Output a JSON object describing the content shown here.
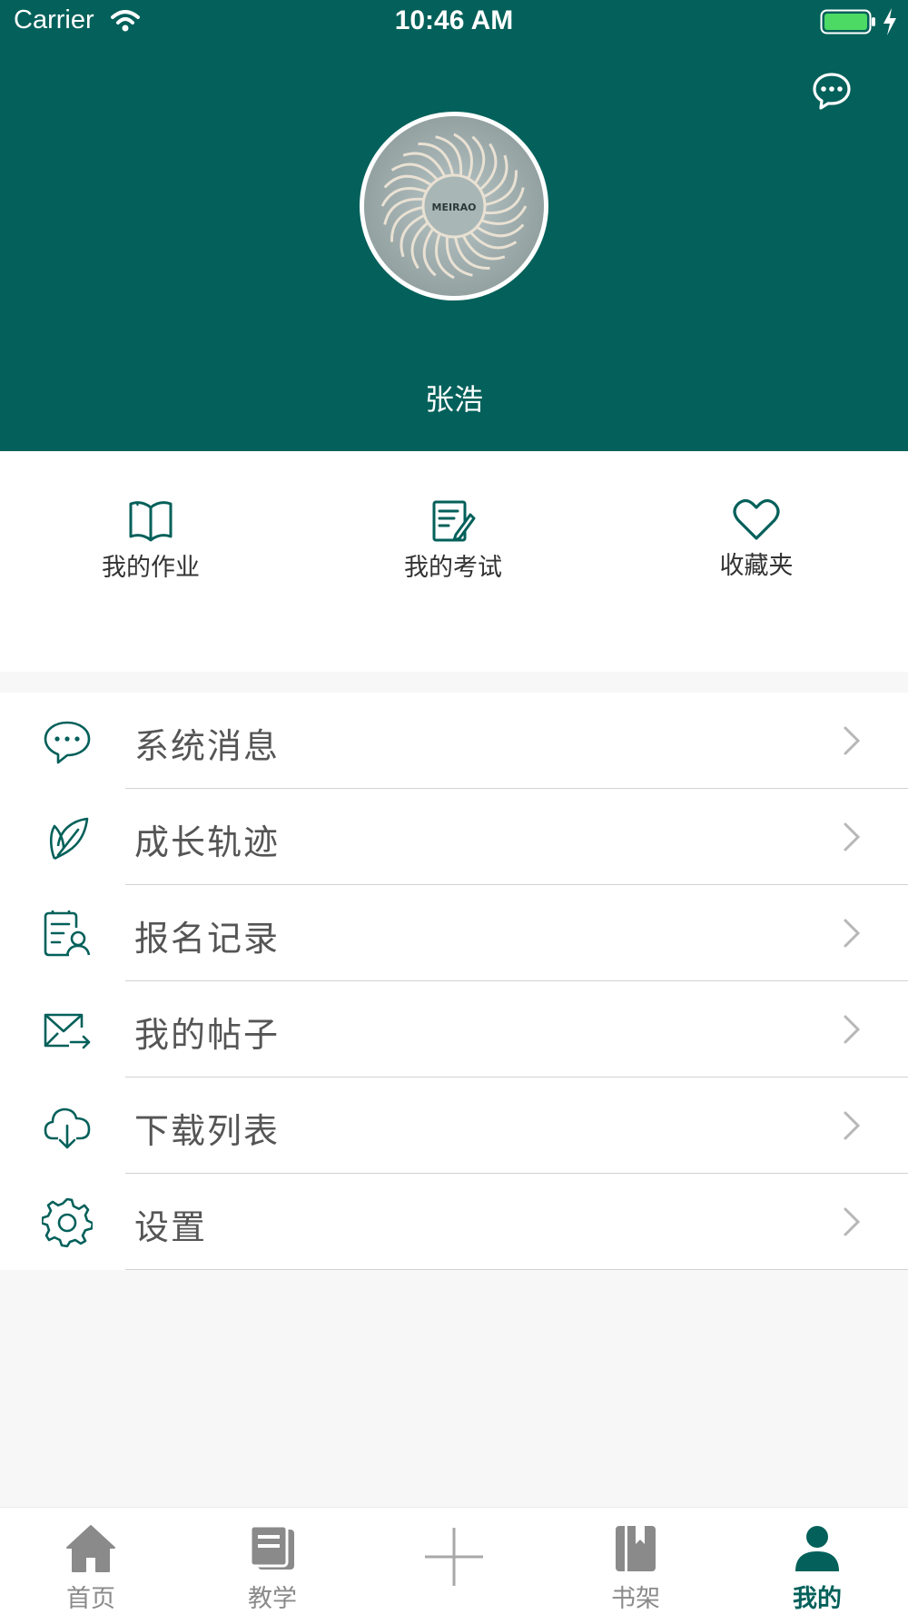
{
  "status_bar": {
    "carrier": "Carrier",
    "time": "10:46 AM"
  },
  "profile": {
    "username": "张浩",
    "avatar_text": "MEIRAO"
  },
  "quick_actions": [
    {
      "label": "我的作业",
      "icon": "book-icon"
    },
    {
      "label": "我的考试",
      "icon": "exam-edit-icon"
    },
    {
      "label": "收藏夹",
      "icon": "heart-icon"
    }
  ],
  "menu": [
    {
      "label": "系统消息",
      "icon": "chat-bubble-icon"
    },
    {
      "label": "成长轨迹",
      "icon": "leaf-icon"
    },
    {
      "label": "报名记录",
      "icon": "registration-record-icon"
    },
    {
      "label": "我的帖子",
      "icon": "mail-forward-icon"
    },
    {
      "label": "下载列表",
      "icon": "cloud-download-icon"
    },
    {
      "label": "设置",
      "icon": "gear-icon"
    }
  ],
  "tabbar": [
    {
      "label": "首页",
      "icon": "home-icon",
      "active": false
    },
    {
      "label": "教学",
      "icon": "teaching-icon",
      "active": false
    },
    {
      "label": "",
      "icon": "plus-icon",
      "active": false
    },
    {
      "label": "书架",
      "icon": "bookshelf-icon",
      "active": false
    },
    {
      "label": "我的",
      "icon": "person-icon",
      "active": true
    }
  ],
  "colors": {
    "primary": "#03605a",
    "background": "#f7f7f7",
    "text": "#555555",
    "tab_inactive": "#8a8a8a"
  }
}
